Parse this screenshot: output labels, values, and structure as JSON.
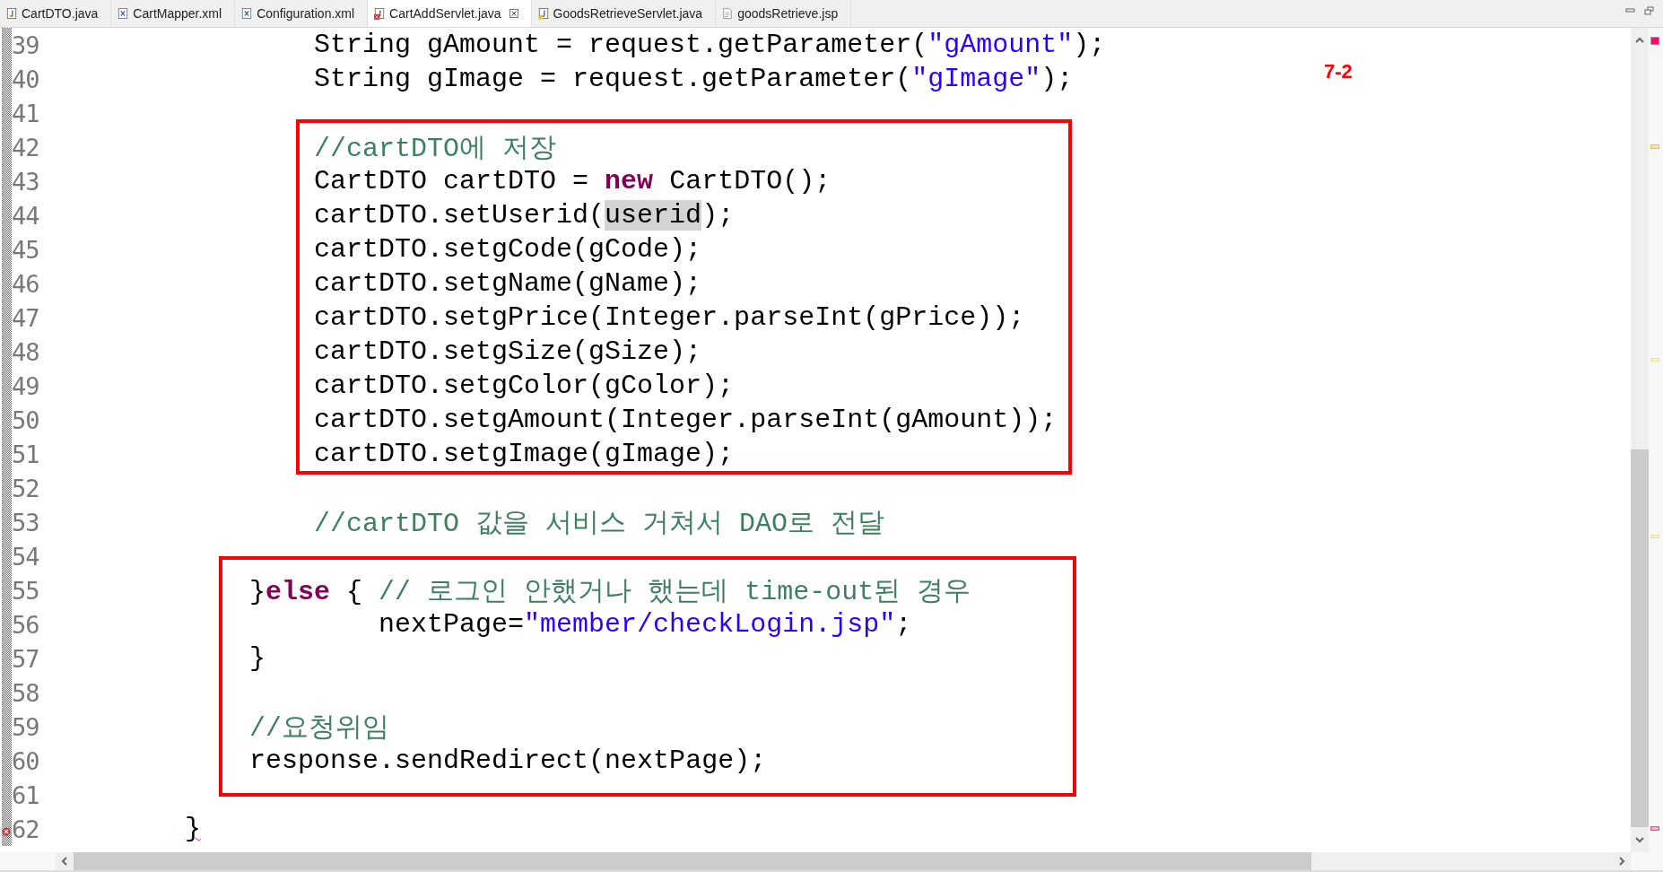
{
  "tabs": [
    {
      "label": "CartDTO.java",
      "kind": "java",
      "selected": false
    },
    {
      "label": "CartMapper.xml",
      "kind": "xml",
      "selected": false
    },
    {
      "label": "Configuration.xml",
      "kind": "xml",
      "selected": false
    },
    {
      "label": "CartAddServlet.java",
      "kind": "java-error",
      "selected": true
    },
    {
      "label": "GoodsRetrieveServlet.java",
      "kind": "java-warning",
      "selected": false
    },
    {
      "label": "goodsRetrieve.jsp",
      "kind": "jsp",
      "selected": false
    }
  ],
  "note": "7-2",
  "blocks": [
    {
      "boxed": false,
      "lines": [
        {
          "number": "39",
          "error": false,
          "tokens": [
            {
              "kind": "plain",
              "text": "                String gAmount = request.getParameter("
            },
            {
              "kind": "string",
              "text": "\"gAmount\""
            },
            {
              "kind": "plain",
              "text": ");"
            }
          ]
        },
        {
          "number": "40",
          "error": false,
          "tokens": [
            {
              "kind": "plain",
              "text": "                String gImage = request.getParameter("
            },
            {
              "kind": "string",
              "text": "\"gImage\""
            },
            {
              "kind": "plain",
              "text": ");"
            }
          ]
        },
        {
          "number": "41",
          "error": false
        }
      ]
    },
    {
      "boxed": true,
      "lines": [
        {
          "number": "42",
          "error": false,
          "tokens": [
            {
              "kind": "comment",
              "text": "                //cartDTO에 저장"
            }
          ]
        },
        {
          "number": "43",
          "error": false,
          "tokens": [
            {
              "kind": "plain",
              "text": "                CartDTO cartDTO = "
            },
            {
              "kind": "keyword",
              "text": "new"
            },
            {
              "kind": "plain",
              "text": " CartDTO();"
            }
          ]
        },
        {
          "number": "44",
          "error": false,
          "tokens": [
            {
              "kind": "plain",
              "text": "                cartDTO.setUserid("
            },
            {
              "kind": "occurrence",
              "text": "userid"
            },
            {
              "kind": "plain",
              "text": ");"
            }
          ]
        },
        {
          "number": "45",
          "error": false,
          "tokens": [
            {
              "kind": "plain",
              "text": "                cartDTO.setgCode(gCode);"
            }
          ]
        },
        {
          "number": "46",
          "error": false,
          "tokens": [
            {
              "kind": "plain",
              "text": "                cartDTO.setgName(gName);"
            }
          ]
        },
        {
          "number": "47",
          "error": false,
          "tokens": [
            {
              "kind": "plain",
              "text": "                cartDTO.setgPrice(Integer.parseInt(gPrice));"
            }
          ]
        },
        {
          "number": "48",
          "error": false,
          "tokens": [
            {
              "kind": "plain",
              "text": "                cartDTO.setgSize(gSize);"
            }
          ]
        },
        {
          "number": "49",
          "error": false,
          "tokens": [
            {
              "kind": "plain",
              "text": "                cartDTO.setgColor(gColor);"
            }
          ]
        },
        {
          "number": "50",
          "error": false,
          "tokens": [
            {
              "kind": "plain",
              "text": "                cartDTO.setgAmount(Integer.parseInt(gAmount));"
            }
          ]
        },
        {
          "number": "51",
          "error": false,
          "tokens": [
            {
              "kind": "plain",
              "text": "                cartDTO.setgImage(gImage);"
            }
          ]
        }
      ]
    },
    {
      "boxed": false,
      "lines": [
        {
          "number": "52",
          "error": false
        },
        {
          "number": "53",
          "error": false,
          "tokens": [
            {
              "kind": "comment",
              "text": "                //cartDTO 값을 서비스 거쳐서 DAO로 전달"
            }
          ]
        },
        {
          "number": "54",
          "error": false
        }
      ]
    },
    {
      "boxed": true,
      "lines": [
        {
          "number": "55",
          "error": false,
          "tokens": [
            {
              "kind": "plain",
              "text": "            }"
            },
            {
              "kind": "keyword",
              "text": "else"
            },
            {
              "kind": "plain",
              "text": " { "
            },
            {
              "kind": "comment",
              "text": "// 로그인 안했거나 했는데 time-out된 경우"
            }
          ]
        },
        {
          "number": "56",
          "error": false,
          "tokens": [
            {
              "kind": "plain",
              "text": "                    nextPage="
            },
            {
              "kind": "string",
              "text": "\"member/checkLogin.jsp\""
            },
            {
              "kind": "plain",
              "text": ";"
            }
          ]
        },
        {
          "number": "57",
          "error": false,
          "tokens": [
            {
              "kind": "plain",
              "text": "            }"
            }
          ]
        },
        {
          "number": "58",
          "error": false
        },
        {
          "number": "59",
          "error": false,
          "tokens": [
            {
              "kind": "comment",
              "text": "            //요청위임"
            }
          ]
        },
        {
          "number": "60",
          "error": false,
          "tokens": [
            {
              "kind": "plain",
              "text": "            response.sendRedirect(nextPage);"
            }
          ]
        }
      ]
    },
    {
      "boxed": false,
      "lines": [
        {
          "number": "61",
          "error": false
        },
        {
          "number": "62",
          "error": true,
          "tokens": [
            {
              "kind": "error",
              "text": "        }"
            }
          ]
        }
      ]
    }
  ]
}
